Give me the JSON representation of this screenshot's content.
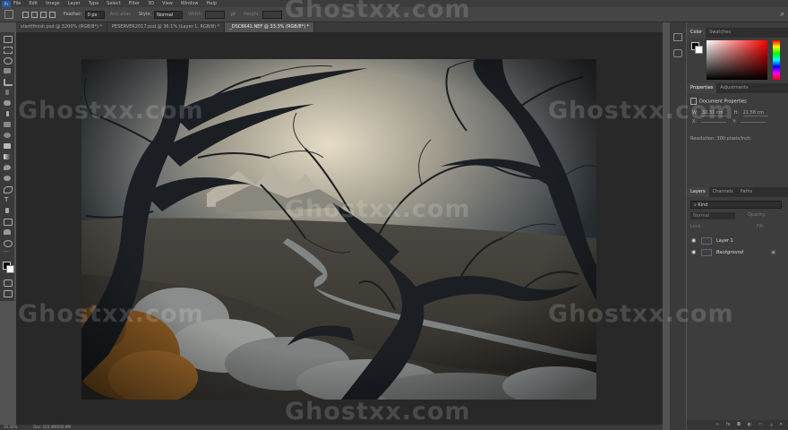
{
  "menubar": {
    "logo": "Ps",
    "items": [
      "File",
      "Edit",
      "Image",
      "Layer",
      "Type",
      "Select",
      "Filter",
      "3D",
      "View",
      "Window",
      "Help"
    ]
  },
  "options": {
    "feather_label": "Feather:",
    "feather_value": "0 px",
    "antialias_label": "Anti-alias",
    "style_label": "Style:",
    "style_value": "Normal",
    "width_label": "Width:",
    "height_label": "Height:"
  },
  "tabs": [
    {
      "label": "starttfinish.psd @ 3200% (RGB/8*) *"
    },
    {
      "label": "PESERVER2017.psd @ 36.1% (Layer 1, RGB/8) *"
    },
    {
      "label": "_DSC6641.NEF @ 33.3% (RGB/8*) *"
    }
  ],
  "status": {
    "zoom": "33.33%",
    "doc": "Doc: 103.4M/206.9M"
  },
  "panels": {
    "color_tab": "Color",
    "swatches_tab": "Swatches",
    "properties_tab": "Properties",
    "adjustments_tab": "Adjustments",
    "doc_props_title": "Document Properties",
    "w_label": "W:",
    "w_value": "32.31 cm",
    "h_label": "H:",
    "h_value": "21.58 cm",
    "x_label": "X:",
    "y_label": "Y:",
    "resolution": "Resolution: 300 pixels/inch",
    "layers_tab": "Layers",
    "channels_tab": "Channels",
    "paths_tab": "Paths",
    "kind_label": "Kind",
    "blend_mode": "Normal",
    "opacity_label": "Opacity:",
    "lock_label": "Lock:",
    "fill_label": "Fill:",
    "layers": [
      {
        "name": "Layer 1"
      },
      {
        "name": "Background"
      }
    ]
  },
  "watermark": "Ghostxx.com"
}
